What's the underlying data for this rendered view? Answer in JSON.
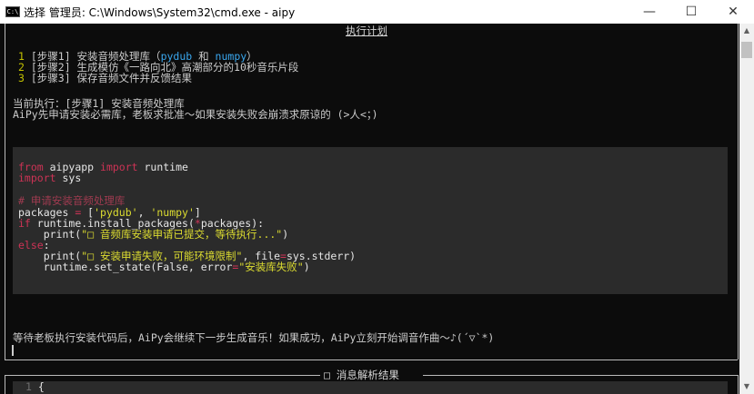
{
  "window": {
    "title": "选择 管理员: C:\\Windows\\System32\\cmd.exe - aipy",
    "icon_label": "C:\\",
    "minimize": "—",
    "maximize": "☐",
    "close": "✕"
  },
  "plan": {
    "title": "执行计划",
    "steps": [
      {
        "num": "1",
        "text": " [步骤1] 安装音频处理库（",
        "hl1": "pydub",
        "mid": " 和 ",
        "hl2": "numpy",
        "end": "）"
      },
      {
        "num": "2",
        "text": " [步骤2] 生成模仿《一路向北》高潮部分的10秒音乐片段"
      },
      {
        "num": "3",
        "text": " [步骤3] 保存音频文件并反馈结果"
      }
    ]
  },
  "current": {
    "line1": "当前执行：[步骤1] 安装音频处理库",
    "line2": "AiPy先申请安装必需库，老板求批准～如果安装失败会崩溃求原谅的 (>人<；)"
  },
  "code": {
    "l1_kw1": "from",
    "l1_mod": " aipyapp ",
    "l1_kw2": "import",
    "l1_name": " runtime",
    "l2_kw": "import",
    "l2_name": " sys",
    "l3_comment": "# 申请安装音频处理库",
    "l4_var": "packages ",
    "l4_eq": "=",
    "l4_open": " [",
    "l4_s1": "'pydub'",
    "l4_comma": ", ",
    "l4_s2": "'numpy'",
    "l4_close": "]",
    "l5_kw": "if",
    "l5_call": " runtime.install_packages(",
    "l5_star": "*",
    "l5_rest": "packages):",
    "l6_print": "    print(",
    "l6_str": "\"□ 音频库安装申请已提交，等待执行...\"",
    "l6_close": ")",
    "l7_kw": "else",
    "l7_colon": ":",
    "l8_print": "    print(",
    "l8_str": "\"□ 安装申请失败，可能环境限制\"",
    "l8_mid": ", file",
    "l8_eq": "=",
    "l8_rest": "sys.stderr)",
    "l9_call": "    runtime.set_state(False, error",
    "l9_eq": "=",
    "l9_str": "\"安装库失败\"",
    "l9_close": ")"
  },
  "footer_message": "等待老板执行安装代码后，AiPy会继续下一步生成音乐！如果成功，AiPy立刻开始调音作曲～♪(´▽`*)",
  "panel": {
    "title": "□ 消息解析结果",
    "line_num": "1",
    "line_text": " {"
  },
  "scrollbar": {
    "up": "▲",
    "down": "▼"
  }
}
